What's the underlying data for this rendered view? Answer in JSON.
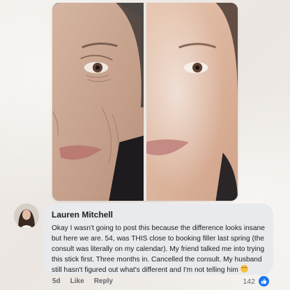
{
  "photo": {
    "before_image": "face-before-photo",
    "after_image": "face-after-photo"
  },
  "comment": {
    "author": "Lauren Mitchell",
    "avatar": "avatar-photo",
    "text": "Okay I wasn't going to post this because the difference looks insane but here we are. 54, was THIS close to booking filler last spring (the consult was literally on my calendar). My friend talked me into trying this stick first. Three months in. Cancelled the consult. My husband still hasn't figured out what's different and I'm not telling him",
    "emoji": "laughing-emoji",
    "timestamp": "5d",
    "like_label": "Like",
    "reply_label": "Reply",
    "reaction_count": "142",
    "reaction_icon": "thumbs-up-icon"
  },
  "colors": {
    "bubble_bg": "#e9eaed",
    "like_blue": "#1877f2",
    "meta_gray": "#65676b"
  }
}
